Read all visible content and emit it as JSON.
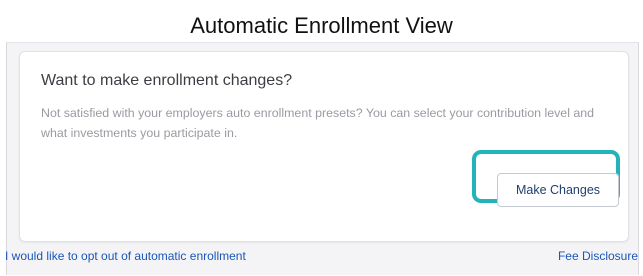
{
  "page": {
    "title": "Automatic Enrollment View"
  },
  "card": {
    "heading": "Want to make enrollment changes?",
    "body": "Not satisfied with your employers auto enrollment presets? You can select your contribution level and what investments you participate in.",
    "button_label": "Make Changes"
  },
  "footer": {
    "opt_out_link": "I would like to opt out of automatic enrollment",
    "fee_link": "Fee Disclosure"
  },
  "colors": {
    "highlight": "#23b3b8",
    "link": "#1a56b8",
    "button_text": "#1f3f6e"
  }
}
